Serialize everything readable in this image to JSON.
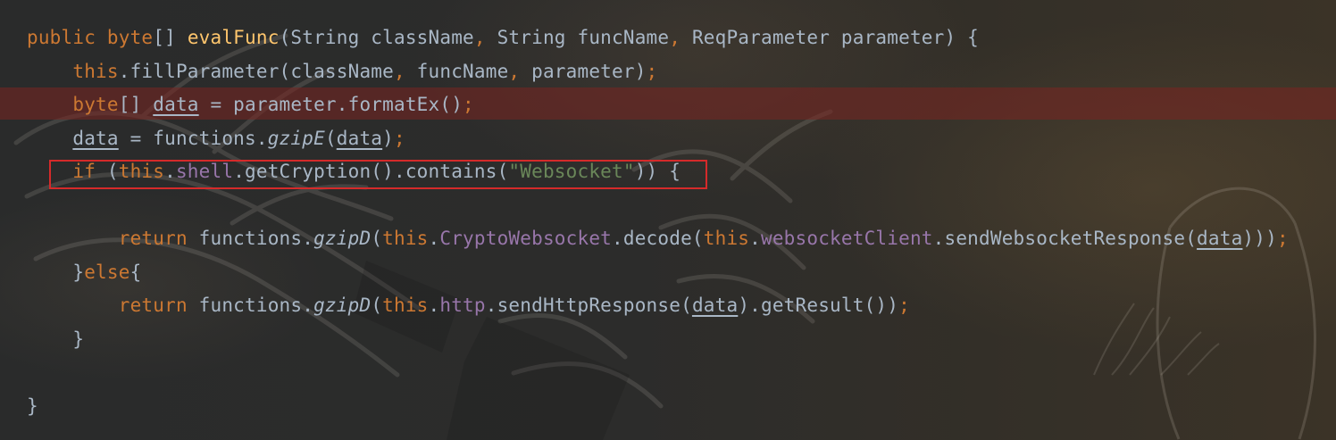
{
  "editor": {
    "lines": [
      [
        {
          "t": "public ",
          "c": "kw"
        },
        {
          "t": "byte",
          "c": "kw"
        },
        {
          "t": "[] ",
          "c": "plain"
        },
        {
          "t": "evalFunc",
          "c": "fn"
        },
        {
          "t": "(String className",
          "c": "plain"
        },
        {
          "t": ", ",
          "c": "kw"
        },
        {
          "t": "String funcName",
          "c": "plain"
        },
        {
          "t": ", ",
          "c": "kw"
        },
        {
          "t": "ReqParameter parameter) {",
          "c": "plain"
        }
      ],
      [
        {
          "t": "    ",
          "c": "plain"
        },
        {
          "t": "this",
          "c": "kw"
        },
        {
          "t": ".fillParameter(className",
          "c": "plain"
        },
        {
          "t": ", ",
          "c": "kw"
        },
        {
          "t": "funcName",
          "c": "plain"
        },
        {
          "t": ", ",
          "c": "kw"
        },
        {
          "t": "parameter)",
          "c": "plain"
        },
        {
          "t": ";",
          "c": "kw"
        }
      ],
      [
        {
          "t": "    ",
          "c": "plain"
        },
        {
          "t": "byte",
          "c": "kw"
        },
        {
          "t": "[] ",
          "c": "plain"
        },
        {
          "t": "data",
          "c": "plain under"
        },
        {
          "t": " = parameter.formatEx()",
          "c": "plain"
        },
        {
          "t": ";",
          "c": "kw"
        }
      ],
      [
        {
          "t": "    ",
          "c": "plain"
        },
        {
          "t": "data",
          "c": "plain under"
        },
        {
          "t": " = functions.",
          "c": "plain"
        },
        {
          "t": "gzipE",
          "c": "plain italic"
        },
        {
          "t": "(",
          "c": "plain"
        },
        {
          "t": "data",
          "c": "plain under"
        },
        {
          "t": ")",
          "c": "plain"
        },
        {
          "t": ";",
          "c": "kw"
        }
      ],
      [
        {
          "t": "    ",
          "c": "plain"
        },
        {
          "t": "if ",
          "c": "kw"
        },
        {
          "t": "(",
          "c": "plain"
        },
        {
          "t": "this",
          "c": "kw"
        },
        {
          "t": ".",
          "c": "plain"
        },
        {
          "t": "shell",
          "c": "field"
        },
        {
          "t": ".getCryption().contains(",
          "c": "plain"
        },
        {
          "t": "\"Websocket\"",
          "c": "str"
        },
        {
          "t": ")) {",
          "c": "plain"
        }
      ],
      [
        {
          "t": "",
          "c": "plain"
        }
      ],
      [
        {
          "t": "        ",
          "c": "plain"
        },
        {
          "t": "return ",
          "c": "kw"
        },
        {
          "t": "functions.",
          "c": "plain"
        },
        {
          "t": "gzipD",
          "c": "plain italic"
        },
        {
          "t": "(",
          "c": "plain"
        },
        {
          "t": "this",
          "c": "kw"
        },
        {
          "t": ".",
          "c": "plain"
        },
        {
          "t": "CryptoWebsocket",
          "c": "field"
        },
        {
          "t": ".decode(",
          "c": "plain"
        },
        {
          "t": "this",
          "c": "kw"
        },
        {
          "t": ".",
          "c": "plain"
        },
        {
          "t": "websocketClient",
          "c": "field"
        },
        {
          "t": ".sendWebsocketResponse(",
          "c": "plain"
        },
        {
          "t": "data",
          "c": "plain under"
        },
        {
          "t": ")))",
          "c": "plain"
        },
        {
          "t": ";",
          "c": "kw"
        }
      ],
      [
        {
          "t": "    }",
          "c": "plain"
        },
        {
          "t": "else",
          "c": "kw"
        },
        {
          "t": "{",
          "c": "plain"
        }
      ],
      [
        {
          "t": "        ",
          "c": "plain"
        },
        {
          "t": "return ",
          "c": "kw"
        },
        {
          "t": "functions.",
          "c": "plain"
        },
        {
          "t": "gzipD",
          "c": "plain italic"
        },
        {
          "t": "(",
          "c": "plain"
        },
        {
          "t": "this",
          "c": "kw"
        },
        {
          "t": ".",
          "c": "plain"
        },
        {
          "t": "http",
          "c": "field"
        },
        {
          "t": ".sendHttpResponse(",
          "c": "plain"
        },
        {
          "t": "data",
          "c": "plain under"
        },
        {
          "t": ").getResult())",
          "c": "plain"
        },
        {
          "t": ";",
          "c": "kw"
        }
      ],
      [
        {
          "t": "    }",
          "c": "plain"
        }
      ],
      [
        {
          "t": "",
          "c": "plain"
        }
      ],
      [
        {
          "t": "}",
          "c": "plain"
        }
      ]
    ],
    "highlighted_line_index": 2,
    "boxed_line_index": 4
  },
  "colors": {
    "keyword": "#cc7832",
    "function": "#ffc66d",
    "plain": "#a9b7c6",
    "field": "#9876aa",
    "string": "#6a8759",
    "highlight": "#7a2421",
    "annotation_box": "#d52a2a"
  }
}
